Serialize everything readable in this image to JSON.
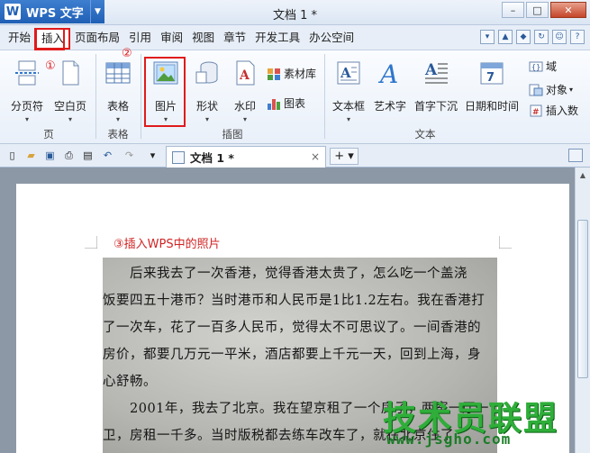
{
  "titlebar": {
    "app_logo": "W",
    "app_name": "WPS 文字",
    "doc_title": "文档 1 *",
    "minimize": "–",
    "maximize": "□",
    "close": "✕"
  },
  "menu": {
    "items": [
      "开始",
      "插入",
      "页面布局",
      "引用",
      "审阅",
      "视图",
      "章节",
      "开发工具",
      "办公空间"
    ],
    "active_index": 1
  },
  "ribbon": {
    "groups": {
      "page": "页",
      "table": "表格",
      "illustration": "插图",
      "text": "文本"
    },
    "tools": {
      "page_break": "分页符",
      "blank_page": "空白页",
      "table": "表格",
      "picture": "图片",
      "shape": "形状",
      "watermark": "水印",
      "material": "素材库",
      "chart": "图表",
      "textbox": "文本框",
      "wordart": "艺术字",
      "dropcap": "首字下沉",
      "datetime": "日期和时间",
      "field": "域",
      "object": "对象",
      "insert_num": "插入数"
    }
  },
  "annotations": {
    "step1": "①",
    "step2": "②"
  },
  "tabbar": {
    "doc_tab": "文档 1 *",
    "close": "×",
    "new_tab": "+ ▾"
  },
  "document": {
    "caption": "③插入WPS中的照片",
    "photo_lines": [
      "　　后来我去了一次香港，觉得香港太贵了，怎么吃一个盖浇",
      "饭要四五十港币？当时港币和人民币是1比1.2左右。我在香港打",
      "了一次车，花了一百多人民币，觉得太不可思议了。一间香港的",
      "房价，都要几万元一平米，酒店都要上千元一天，回到上海，身",
      "心舒畅。",
      "　　2001年，我去了北京。我在望京租了一个房子，两室一厅一",
      "卫，房租一千多。当时版税都去练车改车了，就在北京住了"
    ]
  },
  "watermark": {
    "big": "技术员联盟",
    "small": "www.jsgho.com"
  }
}
